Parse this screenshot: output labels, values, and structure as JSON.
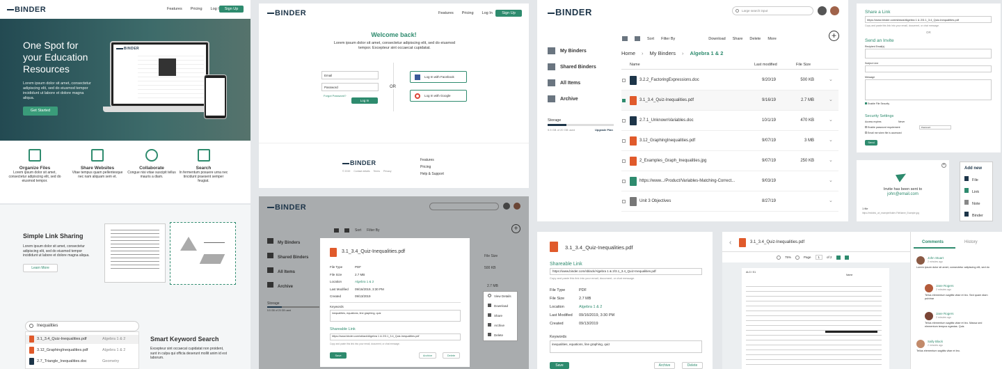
{
  "brand": "BINDER",
  "landing": {
    "nav": [
      "Features",
      "Pricing",
      "Log In"
    ],
    "signup": "Sign Up",
    "hero_title": "One Spot for your Education Resources",
    "hero_text": "Lorem ipsum dolor sit amet, consectetur adipiscing elit, sed do eiusmod tempor incididunt ut labore et dolore magna aliqua.",
    "get_started": "Get Started",
    "features": [
      {
        "title": "Organize Files",
        "text": "Lorem ipsum dolor sit amet, consectetur adipiscing elit, sed do eiusmod tempor."
      },
      {
        "title": "Share Websites",
        "text": "Vitae tempus quam pellentesque nec nam aliquam sem et."
      },
      {
        "title": "Collaborate",
        "text": "Congue nisi vitae suscipit tellus mauris a diam."
      },
      {
        "title": "Search",
        "text": "In fermentum posuere urna nec tincidunt praesent semper feugiat."
      }
    ],
    "link_title": "Simple Link Sharing",
    "link_text": "Lorem ipsum dolor sit amet, consectetur adipiscing elit, sed do eiusmod tempor incididunt ut labore et dolore magna aliqua.",
    "learn_more": "Learn More",
    "search_value": "Inequalities",
    "search_results": [
      {
        "name": "3.1_3.4_Quiz-Inequalities.pdf",
        "folder": "Algebra 1 & 2"
      },
      {
        "name": "3.12_GraphingInequalities.pdf",
        "folder": "Algebra 1 & 2"
      },
      {
        "name": "2.7_Triangle_Inequalities.doc",
        "folder": "Geometry"
      }
    ],
    "keyword_title": "Smart Keyword Search",
    "keyword_text": "Excepteur sint occaecat cupidatat non proident, sunt in culpa qui officia deserunt mollit anim id est laborum."
  },
  "login": {
    "nav": [
      "Features",
      "Pricing",
      "Log In"
    ],
    "signup": "Sign Up",
    "welcome": "Welcome back!",
    "text": "Lorem ipsum dolor sit amet, consectetur adipiscing elit, sed do eiusmod tempor. Excepteur sint occaecat cupidatat.",
    "email_ph": "Email",
    "password_ph": "Password",
    "forgot": "Forgot Password?",
    "login_btn": "Log In",
    "or": "OR",
    "facebook": "Log In with Facebook",
    "google": "Log In with Google",
    "footer_copy": "© 2019",
    "footer_links": [
      "Contact details",
      "Terms",
      "Privacy"
    ],
    "footer_nav": [
      "Features",
      "Pricing",
      "Help & Support"
    ]
  },
  "app": {
    "search_ph": "Large search input",
    "sidebar": [
      "My Binders",
      "Shared Binders",
      "All Items",
      "Archive"
    ],
    "storage_label": "Storage",
    "storage_text": "5.5 GB of 20 GB used",
    "upgrade": "Upgrade Plan",
    "toolbar": {
      "sort": "Sort",
      "filter": "Filter By",
      "download": "Download",
      "share": "Share",
      "delete": "Delete",
      "more": "More"
    },
    "breadcrumb": [
      "Home",
      "My Binders",
      "Algebra 1 & 2"
    ],
    "columns": [
      "Name",
      "Last modified",
      "File Size"
    ],
    "files": [
      {
        "name": "3.2.2_FactoringExpressions.doc",
        "date": "9/20/19",
        "size": "500 KB",
        "type": "doc"
      },
      {
        "name": "3.1_3.4_Quiz-Inequalities.pdf",
        "date": "9/16/19",
        "size": "2.7 MB",
        "type": "pdf",
        "checked": true
      },
      {
        "name": "2.7.1_UnknownVariables.doc",
        "date": "10/1/19",
        "size": "470 KB",
        "type": "doc"
      },
      {
        "name": "3.12_GraphingInequalities.pdf",
        "date": "9/07/19",
        "size": "3 MB",
        "type": "pdf"
      },
      {
        "name": "2_Examples_Graph_Inequalities.jpg",
        "date": "9/07/19",
        "size": "250 KB",
        "type": "img"
      },
      {
        "name": "https://www.../Product/Variables-Matching-Correct...",
        "date": "9/03/19",
        "size": "",
        "type": "link"
      },
      {
        "name": "Unit 3 Objectives",
        "date": "8/27/19",
        "size": "",
        "type": "note"
      }
    ]
  },
  "share": {
    "title": "Share a Link",
    "url": "https://www.binder.com/sblack/Algebra 1 & 2/3.1_3.4_Quiz-Inequalities.pdf",
    "copy_text": "Copy and paste this link into your email, document, or chat message.",
    "or": "OR",
    "invite_title": "Send an Invite",
    "recipient": "Recipient Email(s)",
    "subject": "Subject Line",
    "message": "Message",
    "enable_security": "Enable File Security",
    "security_title": "Security Settings",
    "access": "Access expires",
    "never": "Never",
    "opt1": "Enable password requirement",
    "password": "Password",
    "opt2": "Email me when file is accessed",
    "send": "Send"
  },
  "invite_sent": {
    "text": "Invite has been sent to",
    "email": "john@email.com",
    "file_label": "1 file",
    "file_url": "https://reddink_url_example/folder-FileName_Example.jpg"
  },
  "add_new": {
    "title": "Add new",
    "items": [
      "File",
      "Link",
      "Note",
      "Binder"
    ]
  },
  "modal": {
    "filename": "3.1_3.4_Quiz-Inequalities.pdf",
    "props": [
      [
        "File Type",
        "PDF"
      ],
      [
        "File Size",
        "2.7 MB"
      ],
      [
        "Location",
        "Algebra 1 & 2"
      ],
      [
        "Last Modified",
        "09/16/2019, 3:30 PM"
      ],
      [
        "Created",
        "09/13/2019"
      ]
    ],
    "keywords_label": "Keywords",
    "keywords": "inequalities, equations, line graphing, quiz",
    "link_label": "Shareable Link",
    "link_url": "https://www.binder.com/sblack/Algebra 1 & 2/3.1_3.4_Quiz-Inequalities.pdf",
    "link_help": "Copy and paste this link into your email, document, or chat message.",
    "save": "Save",
    "archive": "Archive",
    "delete": "Delete",
    "context": [
      "View Details",
      "Download",
      "Share",
      "Archive",
      "Delete"
    ],
    "bg_sizes": [
      "500 KB",
      "2.7 MB"
    ],
    "file_size_col": "File Size"
  },
  "viewer": {
    "filename": "3.1_3.4_Quiz-Inequalities.pdf",
    "zoom": "75%",
    "page_label": "Page",
    "page": "1",
    "of": "of 2",
    "tabs": [
      "Comments",
      "History"
    ],
    "doc_title": "ALG I S1",
    "doc_sub": "Name",
    "comments": [
      {
        "name": "John Stuart",
        "time": "2 minutes ago",
        "text": "Lorem ipsum dolor sit amet, consectetur adipiscing elit, sed do"
      },
      {
        "name": "Jane Rogers",
        "time": "2 minutes ago",
        "text": "Tellus elementum sagittis vitae et leo. Sed quam diam pulvinar"
      },
      {
        "name": "Jane Rogers",
        "time": "2 minutes ago",
        "text": "Tellus elementum sagittis vitae et leo. Massa sed elementum tempus egestas. Quis"
      },
      {
        "name": "Sally Black",
        "time": "2 minutes ago",
        "text": "Tellus elementum sagittis vitae et leo."
      }
    ]
  },
  "colors": {
    "accent": "#2e8b6e",
    "navy": "#1d3549",
    "pdf": "#e05a2b"
  }
}
